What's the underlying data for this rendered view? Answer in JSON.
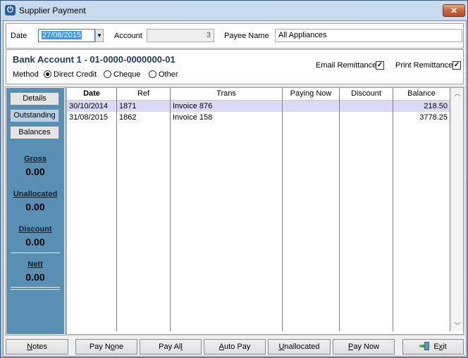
{
  "window": {
    "title": "Supplier Payment",
    "close_label": "✕"
  },
  "header": {
    "date_label": "Date",
    "date_value": "27/08/2015",
    "account_label": "Account",
    "account_value": "3",
    "payee_label": "Payee Name",
    "payee_value": "All Appliances"
  },
  "bank": {
    "title": "Bank Account 1 - 01-0000-0000000-01",
    "method_label": "Method",
    "methods": [
      {
        "label": "Direct Credit",
        "selected": true
      },
      {
        "label": "Cheque",
        "selected": false
      },
      {
        "label": "Other",
        "selected": false
      }
    ],
    "email_remittance_label": "Email Remittance",
    "email_remittance_checked": true,
    "print_remittance_label": "Print Remittance",
    "print_remittance_checked": true
  },
  "side": {
    "buttons": [
      "Details",
      "Outstanding",
      "Balances"
    ],
    "active_button": "Outstanding",
    "gross_label": "Gross",
    "gross_value": "0.00",
    "unallocated_label": "Unallocated",
    "unallocated_value": "0.00",
    "discount_label": "Discount",
    "discount_value": "0.00",
    "nett_label": "Nett",
    "nett_value": "0.00"
  },
  "grid": {
    "columns": [
      "Date",
      "Ref",
      "Trans",
      "Paying Now",
      "Discount",
      "Balance"
    ],
    "rows": [
      {
        "date": "30/10/2014",
        "ref": "1871",
        "trans": "Invoice 876",
        "paying_now": "",
        "discount": "",
        "balance": "218.50",
        "selected": true
      },
      {
        "date": "31/08/2015",
        "ref": "1862",
        "trans": "Invoice 158",
        "paying_now": "",
        "discount": "",
        "balance": "3778.25",
        "selected": false
      }
    ]
  },
  "footer": {
    "notes": {
      "pre": "",
      "u": "N",
      "post": "otes"
    },
    "pay_none": {
      "pre": "Pay N",
      "u": "o",
      "post": "ne"
    },
    "pay_all": {
      "pre": "Pay Al",
      "u": "l",
      "post": ""
    },
    "auto_pay": {
      "pre": "",
      "u": "A",
      "post": "uto Pay"
    },
    "unallocated": {
      "pre": "",
      "u": "U",
      "post": "nallocated"
    },
    "pay_now": {
      "pre": "",
      "u": "P",
      "post": "ay Now"
    },
    "exit": {
      "pre": "E",
      "u": "x",
      "post": "it"
    }
  }
}
